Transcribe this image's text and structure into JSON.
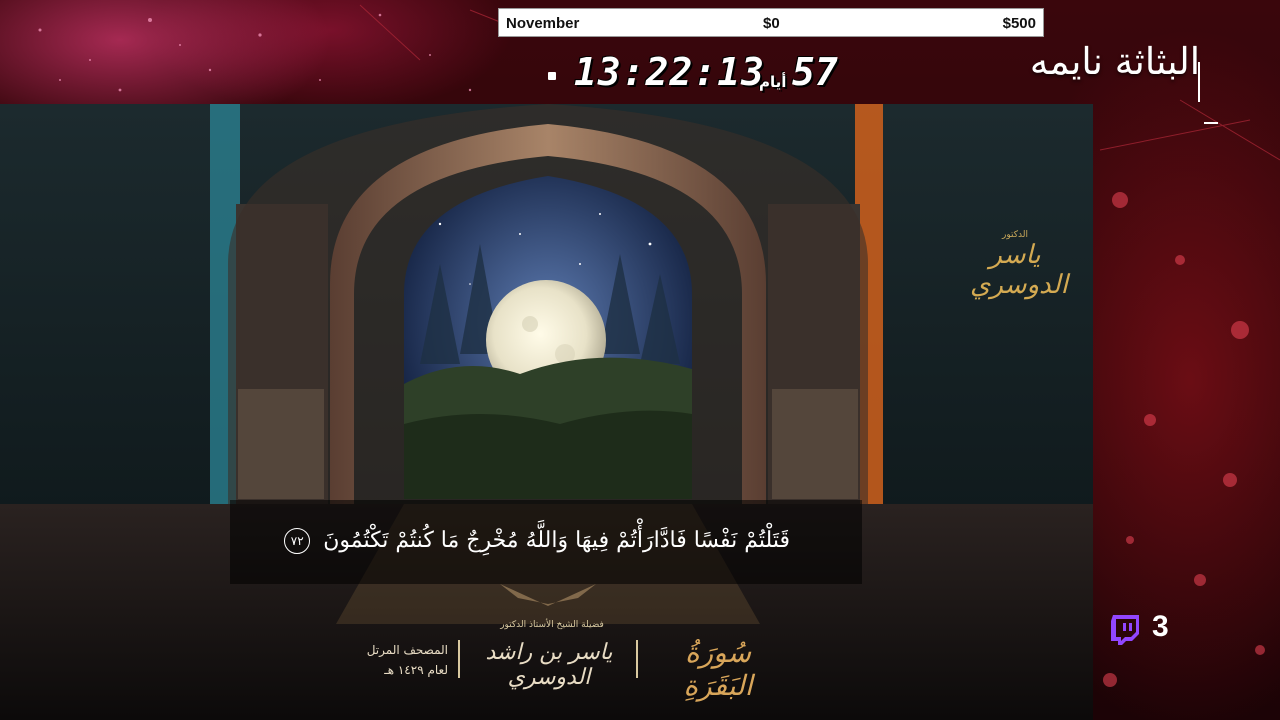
{
  "goal": {
    "month": "November",
    "current": "$0",
    "target": "$500"
  },
  "countdown": {
    "time": "13:22:13",
    "days_label": "أيام",
    "days": "57"
  },
  "streamer_name": "البثاثة نايمه",
  "video": {
    "verse": "قَتَلْتُمْ نَفْسًا فَادَّارَأْتُمْ فِيهَا وَاللَّهُ مُخْرِجٌ مَا كُنتُمْ تَكْتُمُونَ",
    "ayah_number": "٧٢",
    "logo_title": "الدكتور",
    "logo_name": "ياسر الدوسري",
    "reciter_title": "فضيلة الشيخ الأستاذ الدكتور",
    "reciter_name": "ياسر بن راشد الدوسري",
    "mushaf_line1": "المصحف المرتل",
    "mushaf_line2": "لعام ١٤٢٩ هـ",
    "surah": "سُورَةُ البَقَرَةِ"
  },
  "viewers": {
    "count": "3",
    "icon": "twitch-icon",
    "icon_color": "#9146ff"
  },
  "colors": {
    "overlay": "#2a0508",
    "gold": "#d4aa52",
    "goal_bar": "#ffffff"
  }
}
